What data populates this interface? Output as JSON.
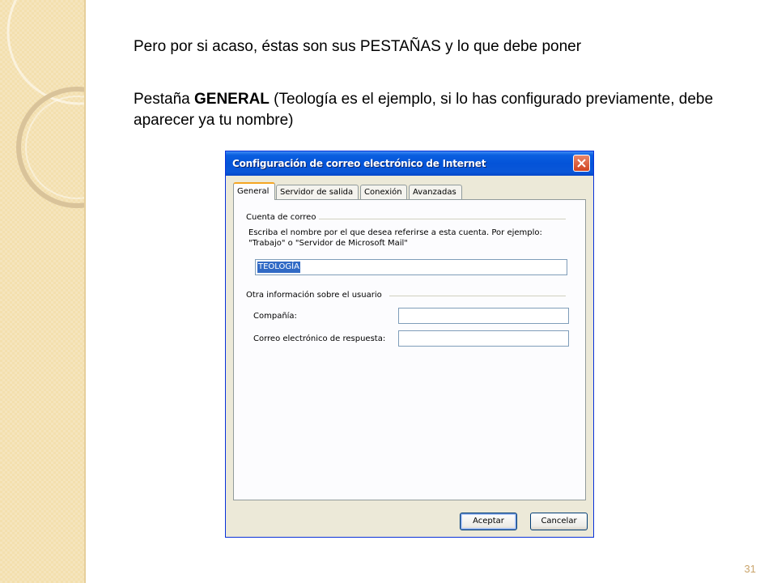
{
  "slide": {
    "heading": "Pero por si acaso, éstas son sus PESTAÑAS y lo que debe poner",
    "intro_prefix": "Pestaña ",
    "intro_bold": "GENERAL",
    "intro_rest": " (Teología es el ejemplo,  si lo has configurado previamente, debe aparecer ya  tu nombre)",
    "page_number": "31"
  },
  "dialog": {
    "title": "Configuración de correo electrónico de Internet",
    "tabs": [
      {
        "label": "General",
        "active": true
      },
      {
        "label": "Servidor de salida",
        "active": false
      },
      {
        "label": "Conexión",
        "active": false
      },
      {
        "label": "Avanzadas",
        "active": false
      }
    ],
    "mail_account": {
      "group_label": "Cuenta de correo",
      "description": "Escriba el nombre por el que desea referirse a esta cuenta. Por ejemplo: \"Trabajo\" o \"Servidor de Microsoft Mail\"",
      "account_value": "TEOLOGÍA"
    },
    "user_info": {
      "group_label": "Otra información sobre el usuario",
      "company_label": "Compañía:",
      "company_value": "",
      "reply_label": "Correo electrónico de respuesta:",
      "reply_value": ""
    },
    "buttons": {
      "ok": "Aceptar",
      "cancel": "Cancelar"
    },
    "colors": {
      "titlebar": "#0453d8",
      "active_tab_accent": "#f5a623",
      "selection": "#316ac5"
    }
  }
}
